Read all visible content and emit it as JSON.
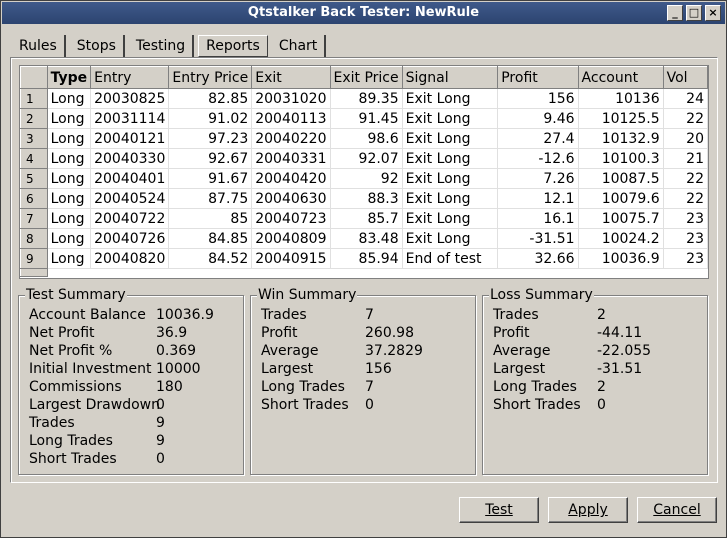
{
  "window": {
    "title": "Qtstalker Back Tester: NewRule"
  },
  "tabs": [
    "Rules",
    "Stops",
    "Testing",
    "Reports",
    "Chart"
  ],
  "active_tab": "Reports",
  "table": {
    "headers": [
      "Type",
      "Entry",
      "Entry Price",
      "Exit",
      "Exit Price",
      "Signal",
      "Profit",
      "Account",
      "Vol"
    ],
    "rows": [
      {
        "n": "1",
        "type": "Long",
        "entry": "20030825",
        "entry_price": "82.85",
        "exit": "20031020",
        "exit_price": "89.35",
        "signal": "Exit Long",
        "profit": "156",
        "account": "10136",
        "vol": "24"
      },
      {
        "n": "2",
        "type": "Long",
        "entry": "20031114",
        "entry_price": "91.02",
        "exit": "20040113",
        "exit_price": "91.45",
        "signal": "Exit Long",
        "profit": "9.46",
        "account": "10125.5",
        "vol": "22"
      },
      {
        "n": "3",
        "type": "Long",
        "entry": "20040121",
        "entry_price": "97.23",
        "exit": "20040220",
        "exit_price": "98.6",
        "signal": "Exit Long",
        "profit": "27.4",
        "account": "10132.9",
        "vol": "20"
      },
      {
        "n": "4",
        "type": "Long",
        "entry": "20040330",
        "entry_price": "92.67",
        "exit": "20040331",
        "exit_price": "92.07",
        "signal": "Exit Long",
        "profit": "-12.6",
        "account": "10100.3",
        "vol": "21"
      },
      {
        "n": "5",
        "type": "Long",
        "entry": "20040401",
        "entry_price": "91.67",
        "exit": "20040420",
        "exit_price": "92",
        "signal": "Exit Long",
        "profit": "7.26",
        "account": "10087.5",
        "vol": "22"
      },
      {
        "n": "6",
        "type": "Long",
        "entry": "20040524",
        "entry_price": "87.75",
        "exit": "20040630",
        "exit_price": "88.3",
        "signal": "Exit Long",
        "profit": "12.1",
        "account": "10079.6",
        "vol": "22"
      },
      {
        "n": "7",
        "type": "Long",
        "entry": "20040722",
        "entry_price": "85",
        "exit": "20040723",
        "exit_price": "85.7",
        "signal": "Exit Long",
        "profit": "16.1",
        "account": "10075.7",
        "vol": "23"
      },
      {
        "n": "8",
        "type": "Long",
        "entry": "20040726",
        "entry_price": "84.85",
        "exit": "20040809",
        "exit_price": "83.48",
        "signal": "Exit Long",
        "profit": "-31.51",
        "account": "10024.2",
        "vol": "23"
      },
      {
        "n": "9",
        "type": "Long",
        "entry": "20040820",
        "entry_price": "84.52",
        "exit": "20040915",
        "exit_price": "85.94",
        "signal": "End of test",
        "profit": "32.66",
        "account": "10036.9",
        "vol": "23"
      }
    ]
  },
  "test_summary": {
    "title": "Test Summary",
    "items": [
      {
        "k": "Account Balance",
        "v": "10036.9"
      },
      {
        "k": "Net Profit",
        "v": "36.9"
      },
      {
        "k": "Net Profit %",
        "v": "0.369"
      },
      {
        "k": "Initial Investment",
        "v": "10000"
      },
      {
        "k": "Commissions",
        "v": "180"
      },
      {
        "k": "Largest Drawdown",
        "v": "0"
      },
      {
        "k": "Trades",
        "v": "9"
      },
      {
        "k": "Long Trades",
        "v": "9"
      },
      {
        "k": "Short Trades",
        "v": "0"
      }
    ]
  },
  "win_summary": {
    "title": "Win Summary",
    "items": [
      {
        "k": "Trades",
        "v": "7"
      },
      {
        "k": "Profit",
        "v": "260.98"
      },
      {
        "k": "Average",
        "v": "37.2829"
      },
      {
        "k": "Largest",
        "v": "156"
      },
      {
        "k": "Long Trades",
        "v": "7"
      },
      {
        "k": "Short Trades",
        "v": "0"
      }
    ]
  },
  "loss_summary": {
    "title": "Loss Summary",
    "items": [
      {
        "k": "Trades",
        "v": "2"
      },
      {
        "k": "Profit",
        "v": "-44.11"
      },
      {
        "k": "Average",
        "v": "-22.055"
      },
      {
        "k": "Largest",
        "v": "-31.51"
      },
      {
        "k": "Long Trades",
        "v": "2"
      },
      {
        "k": "Short Trades",
        "v": "0"
      }
    ]
  },
  "buttons": {
    "test": "Test",
    "apply": "Apply",
    "cancel": "Cancel"
  }
}
